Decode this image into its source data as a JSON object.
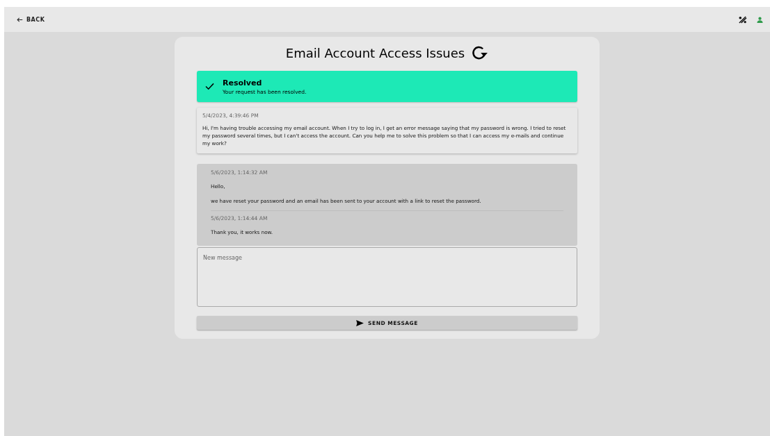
{
  "topbar": {
    "back": "BACK"
  },
  "ticket": {
    "title": "Email Account Access Issues",
    "status": {
      "resolved": true,
      "label": "Resolved",
      "text": "Your request has been resolved."
    },
    "request": {
      "time": "5/4/2023, 4:39:46 PM",
      "text": "Hi, I'm having trouble accessing my email account. When I try to log in, I get an error message saying that my password is wrong. I tried to reset my password several times, but I can't access the account. Can you help me to solve this problem so that I can access my e-mails and continue my work?"
    },
    "replies": [
      {
        "time": "5/6/2023, 1:14:32 AM",
        "paragraphs": [
          "Hello,",
          "we have reset your password and an email has been sent to your account with a link to reset the password."
        ]
      },
      {
        "time": "5/6/2023, 1:14:44 AM",
        "paragraphs": [
          "Thank you, it works now."
        ]
      }
    ],
    "composer": {
      "placeholder": "New message",
      "button": "SEND MESSAGE"
    }
  }
}
